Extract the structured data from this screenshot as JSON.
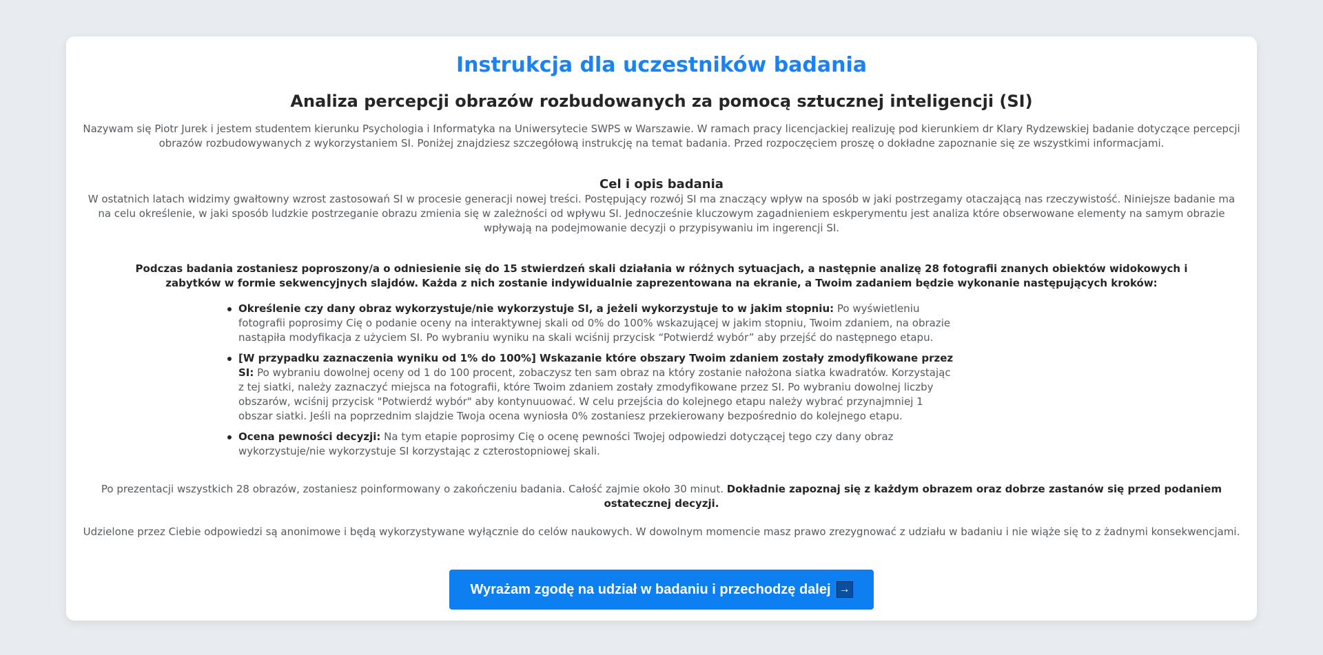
{
  "page": {
    "title": "Instrukcja dla uczestników badania",
    "subtitle": "Analiza percepcji obrazów rozbudowanych za pomocą sztucznej inteligencji (SI)",
    "intro": "Nazywam się Piotr Jurek i jestem studentem kierunku Psychologia i Informatyka na Uniwersytecie SWPS w Warszawie. W ramach pracy licencjackiej realizuję pod kierunkiem dr Klary Rydzewskiej badanie dotyczące percepcji obrazów rozbudowywanych z wykorzystaniem SI. Poniżej znajdziesz szczegółową instrukcję na temat badania. Przed rozpoczęciem proszę o dokładne zapoznanie się ze wszystkimi informacjami."
  },
  "goal": {
    "heading": "Cel i opis badania",
    "text": "W ostatnich latach widzimy gwałtowny wzrost zastosowań SI w procesie generacji nowej treści. Postępujący rozwój SI ma znaczący wpływ na sposób w jaki postrzegamy otaczającą nas rzeczywistość. Niniejsze badanie ma na celu określenie, w jaki sposób ludzkie postrzeganie obrazu zmienia się w zależności od wpływu SI. Jednocześnie kluczowym zagadnieniem eskperymentu jest analiza które obserwowane elementy na samym obrazie wpływają na podejmowanie decyzji o przypisywaniu im ingerencji SI."
  },
  "task": {
    "intro": "Podczas badania zostaniesz poproszony/a o odniesienie się do 15 stwierdzeń skali działania w różnych sytuacjach, a następnie analizę 28 fotografii znanych obiektów widokowych i zabytków w formie sekwencyjnych slajdów. Każda z nich zostanie indywidualnie zaprezentowana na ekranie, a Twoim zadaniem będzie wykonanie następujących kroków:",
    "steps": [
      {
        "title": "Określenie czy dany obraz wykorzystuje/nie wykorzystuje SI, a jeżeli wykorzystuje to w jakim stopniu:",
        "text": " Po wyświetleniu fotografii poprosimy Cię o podanie oceny na interaktywnej skali od 0% do 100% wskazującej w jakim stopniu, Twoim zdaniem, na obrazie nastąpiła modyfikacja z użyciem SI. Po wybraniu wyniku na skali wciśnij przycisk “Potwierdź wybór” aby przejść do następnego etapu."
      },
      {
        "title": "[W przypadku zaznaczenia wyniku od 1% do 100%] Wskazanie które obszary Twoim zdaniem zostały zmodyfikowane przez SI:",
        "text": " Po wybraniu dowolnej oceny od 1 do 100 procent, zobaczysz ten sam obraz na który zostanie nałożona siatka kwadratów. Korzystając z tej siatki, należy zaznaczyć miejsca na fotografii, które Twoim zdaniem zostały zmodyfikowane przez SI. Po wybraniu dowolnej liczby obszarów, wciśnij przycisk \"Potwierdź wybór\" aby kontynuuować. W celu przejścia do kolejnego etapu należy wybrać przynajmniej 1 obszar siatki. Jeśli na poprzednim slajdzie Twoja ocena wyniosła 0% zostaniesz przekierowany bezpośrednio do kolejnego etapu."
      },
      {
        "title": "Ocena pewności decyzji:",
        "text": " Na tym etapie poprosimy Cię o ocenę pewności Twojej odpowiedzi dotyczącej tego czy dany obraz wykorzystuje/nie wykorzystuje SI korzystając z czterostopniowej skali."
      }
    ]
  },
  "summary": {
    "text": "Po prezentacji wszystkich 28 obrazów, zostaniesz poinformowany o zakończeniu badania. Całość zajmie około 30 minut. ",
    "bold": "Dokładnie zapoznaj się z każdym obrazem oraz dobrze zastanów się przed podaniem ostatecznej decyzji."
  },
  "anonymity": "Udzielone przez Ciebie odpowiedzi są anonimowe i będą wykorzystywane wyłącznie do celów naukowych. W dowolnym momencie masz prawo zrezygnować z udziału w badaniu i nie wiąże się to z żadnymi konsekwencjami.",
  "cta": {
    "label": "Wyrażam zgodę na udział w badaniu i przechodzę dalej",
    "icon": "arrow-right-icon",
    "icon_glyph": "→"
  },
  "colors": {
    "background": "#e9ecef",
    "title": "#1a82f5",
    "button": "#0d7ff0"
  }
}
